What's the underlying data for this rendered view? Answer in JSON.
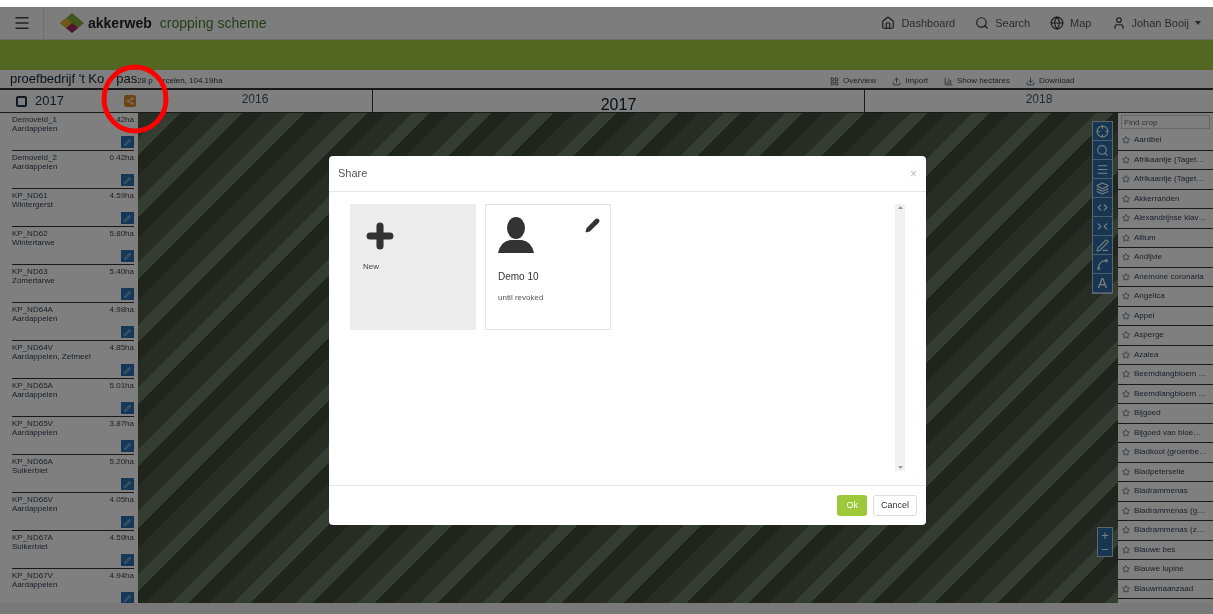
{
  "header": {
    "brand": "akkerweb",
    "app_title": "cropping scheme",
    "nav": [
      {
        "kind": "home",
        "label": "Dashboard"
      },
      {
        "kind": "search",
        "label": "Search"
      },
      {
        "kind": "globe",
        "label": "Map"
      },
      {
        "kind": "user",
        "label": "Johan Booij"
      }
    ]
  },
  "farm": {
    "name_parts": [
      "proefbedrijf 't Ko",
      "pas"
    ],
    "summary_parts": [
      "28 p",
      "rcelen, 104.19ha"
    ]
  },
  "toolbar": [
    {
      "kind": "grid",
      "label": "Overview"
    },
    {
      "kind": "import",
      "label": "Import"
    },
    {
      "kind": "chart",
      "label": "Show hectares"
    },
    {
      "kind": "download",
      "label": "Download"
    }
  ],
  "year_row": {
    "checkbox": {
      "label": "2017",
      "checked": false
    },
    "years": [
      {
        "label": "2016",
        "current": false
      },
      {
        "label": "2017",
        "current": true
      },
      {
        "label": "2018",
        "current": false
      }
    ]
  },
  "fields": [
    {
      "name": "Demoveld_1",
      "area": "42ha",
      "crop": "Aardappelen"
    },
    {
      "name": "Demoveld_2",
      "area": "0.42ha",
      "crop": "Aardappelen"
    },
    {
      "name": "KP_ND61",
      "area": "4.59ha",
      "crop": "Wintergerst"
    },
    {
      "name": "KP_ND62",
      "area": "5.80ha",
      "crop": "Wintertarwe"
    },
    {
      "name": "KP_ND63",
      "area": "5.40ha",
      "crop": "Zomertarwe"
    },
    {
      "name": "KP_ND64A",
      "area": "4.98ha",
      "crop": "Aardappelen"
    },
    {
      "name": "KP_ND64V",
      "area": "4.85ha",
      "crop": "Aardappelen, Zetmeel"
    },
    {
      "name": "KP_ND65A",
      "area": "5.01ha",
      "crop": "Aardappelen"
    },
    {
      "name": "KP_ND65V",
      "area": "3.87ha",
      "crop": "Aardappelen"
    },
    {
      "name": "KP_ND66A",
      "area": "5.20ha",
      "crop": "Suikerbiet"
    },
    {
      "name": "KP_ND66V",
      "area": "4.05ha",
      "crop": "Aardappelen"
    },
    {
      "name": "KP_ND67A",
      "area": "4.59ha",
      "crop": "Suikerbiet"
    },
    {
      "name": "KP_ND67V",
      "area": "4.94ha",
      "crop": "Aardappelen"
    }
  ],
  "map_tools": [
    {
      "kind": "locate"
    },
    {
      "kind": "zoom"
    },
    {
      "kind": "list"
    },
    {
      "kind": "layers"
    },
    {
      "kind": "split"
    },
    {
      "kind": "merge"
    },
    {
      "kind": "draw"
    },
    {
      "kind": "path"
    },
    {
      "kind": "text",
      "label": "A"
    }
  ],
  "zoom_controls": [
    "+",
    "−"
  ],
  "crop_search": {
    "placeholder": "Find crop"
  },
  "crops": [
    "Aardbei",
    "Afrikaantje (Taget…",
    "Afrikaantje (Taget…",
    "Akkerranden",
    "Alexandrijnse klav…",
    "Allium",
    "Andijvie",
    "Anemone coronaria",
    "Angelica",
    "Appel",
    "Asperge",
    "Azalea",
    "Beemdlangbloem …",
    "Beemdlangbloem …",
    "Bijgoed",
    "Bijgoed van bloe…",
    "Bladkool (groenbe…",
    "Bladpeterselie",
    "Bladrammenas",
    "Bladrammenas (g…",
    "Bladrammenas (z…",
    "Blauwe bes",
    "Blauwe lupine",
    "Blauwmaanzaad"
  ],
  "modal": {
    "title": "Share",
    "close": "×",
    "cards": [
      {
        "kind": "new",
        "label": "New"
      },
      {
        "kind": "person",
        "name": "Demo 10",
        "subtitle": "until revoked"
      }
    ],
    "buttons": [
      {
        "kind": "primary",
        "label": "Ok"
      },
      {
        "kind": "default",
        "label": "Cancel"
      }
    ]
  }
}
